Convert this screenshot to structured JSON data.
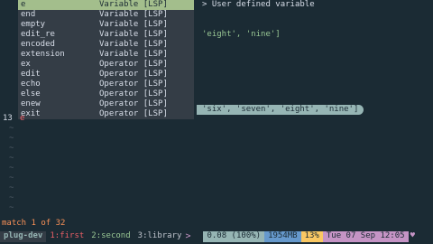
{
  "completion": {
    "items": [
      {
        "word": "e",
        "kind": "Variable [LSP]"
      },
      {
        "word": "end",
        "kind": "Variable [LSP]"
      },
      {
        "word": "empty",
        "kind": "Variable [LSP]"
      },
      {
        "word": "edit_re",
        "kind": "Variable [LSP]"
      },
      {
        "word": "encoded",
        "kind": "Variable [LSP]"
      },
      {
        "word": "extension",
        "kind": "Variable [LSP]"
      },
      {
        "word": "ex",
        "kind": "Operator [LSP]"
      },
      {
        "word": "edit",
        "kind": "Operator [LSP]"
      },
      {
        "word": "echo",
        "kind": "Operator [LSP]"
      },
      {
        "word": "else",
        "kind": "Operator [LSP]"
      },
      {
        "word": "enew",
        "kind": "Operator [LSP]"
      },
      {
        "word": "exit",
        "kind": "Operator [LSP]"
      }
    ],
    "selected_index": 0,
    "doc_arrow": ">",
    "doc": "User defined variable"
  },
  "buffer": {
    "line3_text": "'eight', 'nine']",
    "hint_text": "'six', 'seven', 'eight', 'nine']",
    "current_line_number": "13",
    "cursor_char": "e",
    "tilde": "~"
  },
  "cmdline": {
    "text": "match 1 of 32"
  },
  "tmux": {
    "session": "plug-dev",
    "windows": [
      {
        "label": "1:first"
      },
      {
        "label": "2:second"
      },
      {
        "label": "3:library"
      }
    ],
    "arrow": ">",
    "load": "0.08 (100%)",
    "memory": "1954MB",
    "cpu": "13%",
    "datetime": "Tue 07 Sep 12:05",
    "heart": "♥"
  },
  "colors": {
    "background": "#1b2b34",
    "popup": "#343d46",
    "selected": "#a3be8c",
    "string": "#99c794",
    "hint": "#96b5b4",
    "accent": "#c594c5"
  }
}
